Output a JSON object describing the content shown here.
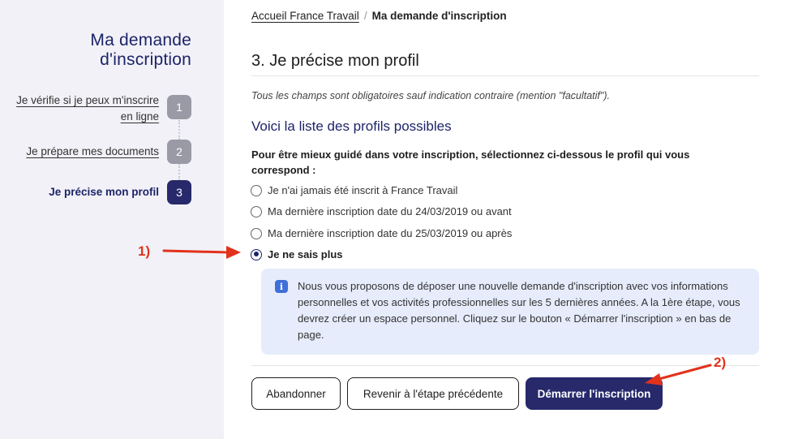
{
  "sidebar": {
    "title_line1": "Ma demande",
    "title_line2": "d'inscription",
    "steps": [
      {
        "label_line1": "Je vérifie si je peux m'inscrire",
        "label_line2": "en ligne",
        "number": "1"
      },
      {
        "label": "Je prépare mes documents",
        "number": "2"
      },
      {
        "label": "Je précise mon profil",
        "number": "3"
      }
    ]
  },
  "breadcrumb": {
    "home": "Accueil France Travail",
    "separator": "/",
    "current": "Ma demande d'inscription"
  },
  "main": {
    "section_title": "3. Je précise mon profil",
    "required_note": "Tous les champs sont obligatoires sauf indication contraire (mention \"facultatif\").",
    "subtitle": "Voici la liste des profils possibles",
    "question": "Pour être mieux guidé dans votre inscription, sélectionnez ci-dessous le profil qui vous correspond :",
    "options": [
      {
        "label": "Je n'ai jamais été inscrit à France Travail",
        "checked": false
      },
      {
        "label": "Ma dernière inscription date du 24/03/2019 ou avant",
        "checked": false
      },
      {
        "label": "Ma dernière inscription date du 25/03/2019 ou après",
        "checked": false
      },
      {
        "label": "Je ne sais plus",
        "checked": true
      }
    ],
    "info": {
      "icon": "i",
      "text": "Nous vous proposons de déposer une nouvelle demande d'inscription avec vos informations personnelles et vos activités professionnelles sur les 5 dernières années. A la 1ère étape, vous devrez créer un espace personnel. Cliquez sur le bouton « Démarrer l'inscription » en bas de page."
    },
    "buttons": {
      "cancel": "Abandonner",
      "previous": "Revenir à l'étape précédente",
      "start": "Démarrer l'inscription"
    }
  },
  "annotations": {
    "first": "1)",
    "second": "2)",
    "color": "#e2321c"
  },
  "colors": {
    "brand_navy": "#27296b",
    "title_navy": "#1d2469",
    "info_bg": "#e6ecfb",
    "info_icon": "#3f6fd8",
    "sidebar_bg": "#f1f1f7",
    "step_inactive": "#9a9aa6"
  }
}
